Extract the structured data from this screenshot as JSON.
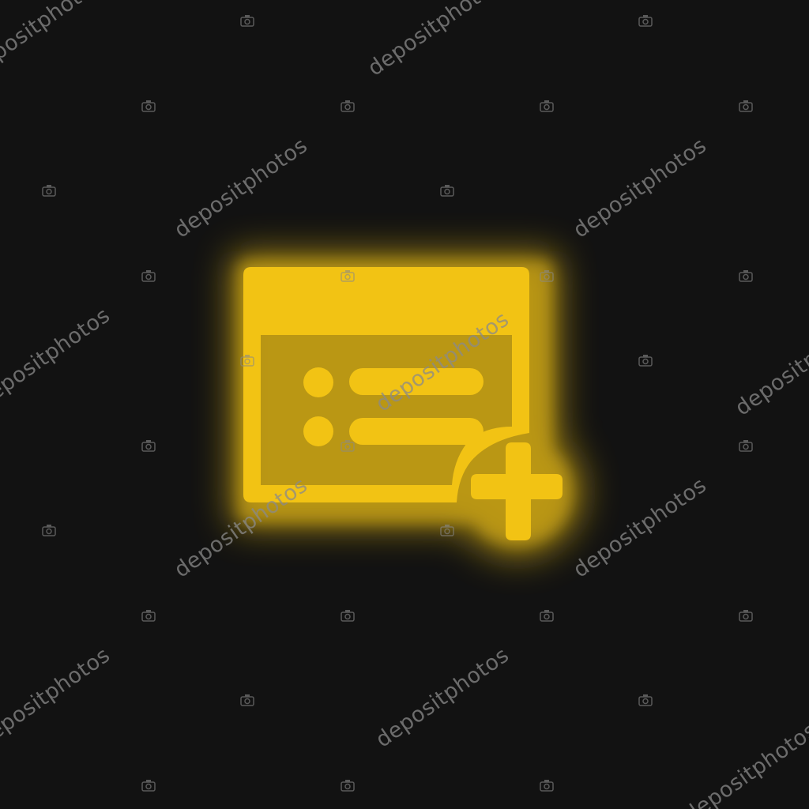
{
  "icon": {
    "name": "add-to-list-window-icon",
    "style": "neon-glow",
    "fill_color": "#F2C314",
    "glow_color": "#F2C314",
    "background_color": "#121212",
    "parts": [
      "window-frame",
      "title-bar",
      "list-bullet-1",
      "list-line-1",
      "list-bullet-2",
      "list-line-2",
      "plus-sign"
    ]
  },
  "watermark": {
    "text": "depositphotos",
    "color": "#8A8A8A",
    "camera_icon": "camera-icon"
  }
}
